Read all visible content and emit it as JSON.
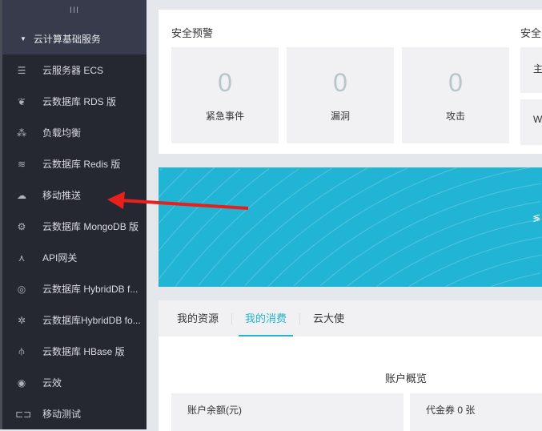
{
  "sidebar": {
    "handle": "III",
    "group": "云计算基础服务",
    "items": [
      {
        "label": "云服务器 ECS",
        "icon": "server-icon"
      },
      {
        "label": "云数据库 RDS 版",
        "icon": "database-icon"
      },
      {
        "label": "负载均衡",
        "icon": "load-balancer-icon"
      },
      {
        "label": "云数据库 Redis 版",
        "icon": "redis-icon"
      },
      {
        "label": "移动推送",
        "icon": "cloud-push-icon"
      },
      {
        "label": "云数据库 MongoDB 版",
        "icon": "mongodb-icon"
      },
      {
        "label": "API网关",
        "icon": "api-gateway-icon"
      },
      {
        "label": "云数据库 HybridDB f...",
        "icon": "hybriddb-icon"
      },
      {
        "label": "云数据库HybridDB fo...",
        "icon": "hybriddb-network-icon"
      },
      {
        "label": "云数据库 HBase 版",
        "icon": "hbase-icon"
      },
      {
        "label": "云效",
        "icon": "yunxiao-icon"
      },
      {
        "label": "移动测试",
        "icon": "mobile-test-icon"
      }
    ]
  },
  "security": {
    "title": "安全预警",
    "title2": "安全",
    "boxes": [
      {
        "num": "0",
        "label": "紧急事件"
      },
      {
        "num": "0",
        "label": "漏洞"
      },
      {
        "num": "0",
        "label": "攻击"
      }
    ],
    "side": [
      "主",
      "W"
    ]
  },
  "banner": {
    "text": "≶"
  },
  "tabs": {
    "items": [
      "我的资源",
      "我的消费",
      "云大使"
    ],
    "active": 1
  },
  "overview": {
    "title": "账户概览",
    "balance": "账户余额(元)",
    "coupon": "代金券 0 张"
  },
  "colors": {
    "accent": "#22b4d4",
    "sidebar": "#252731",
    "arrow": "#e8201c"
  }
}
